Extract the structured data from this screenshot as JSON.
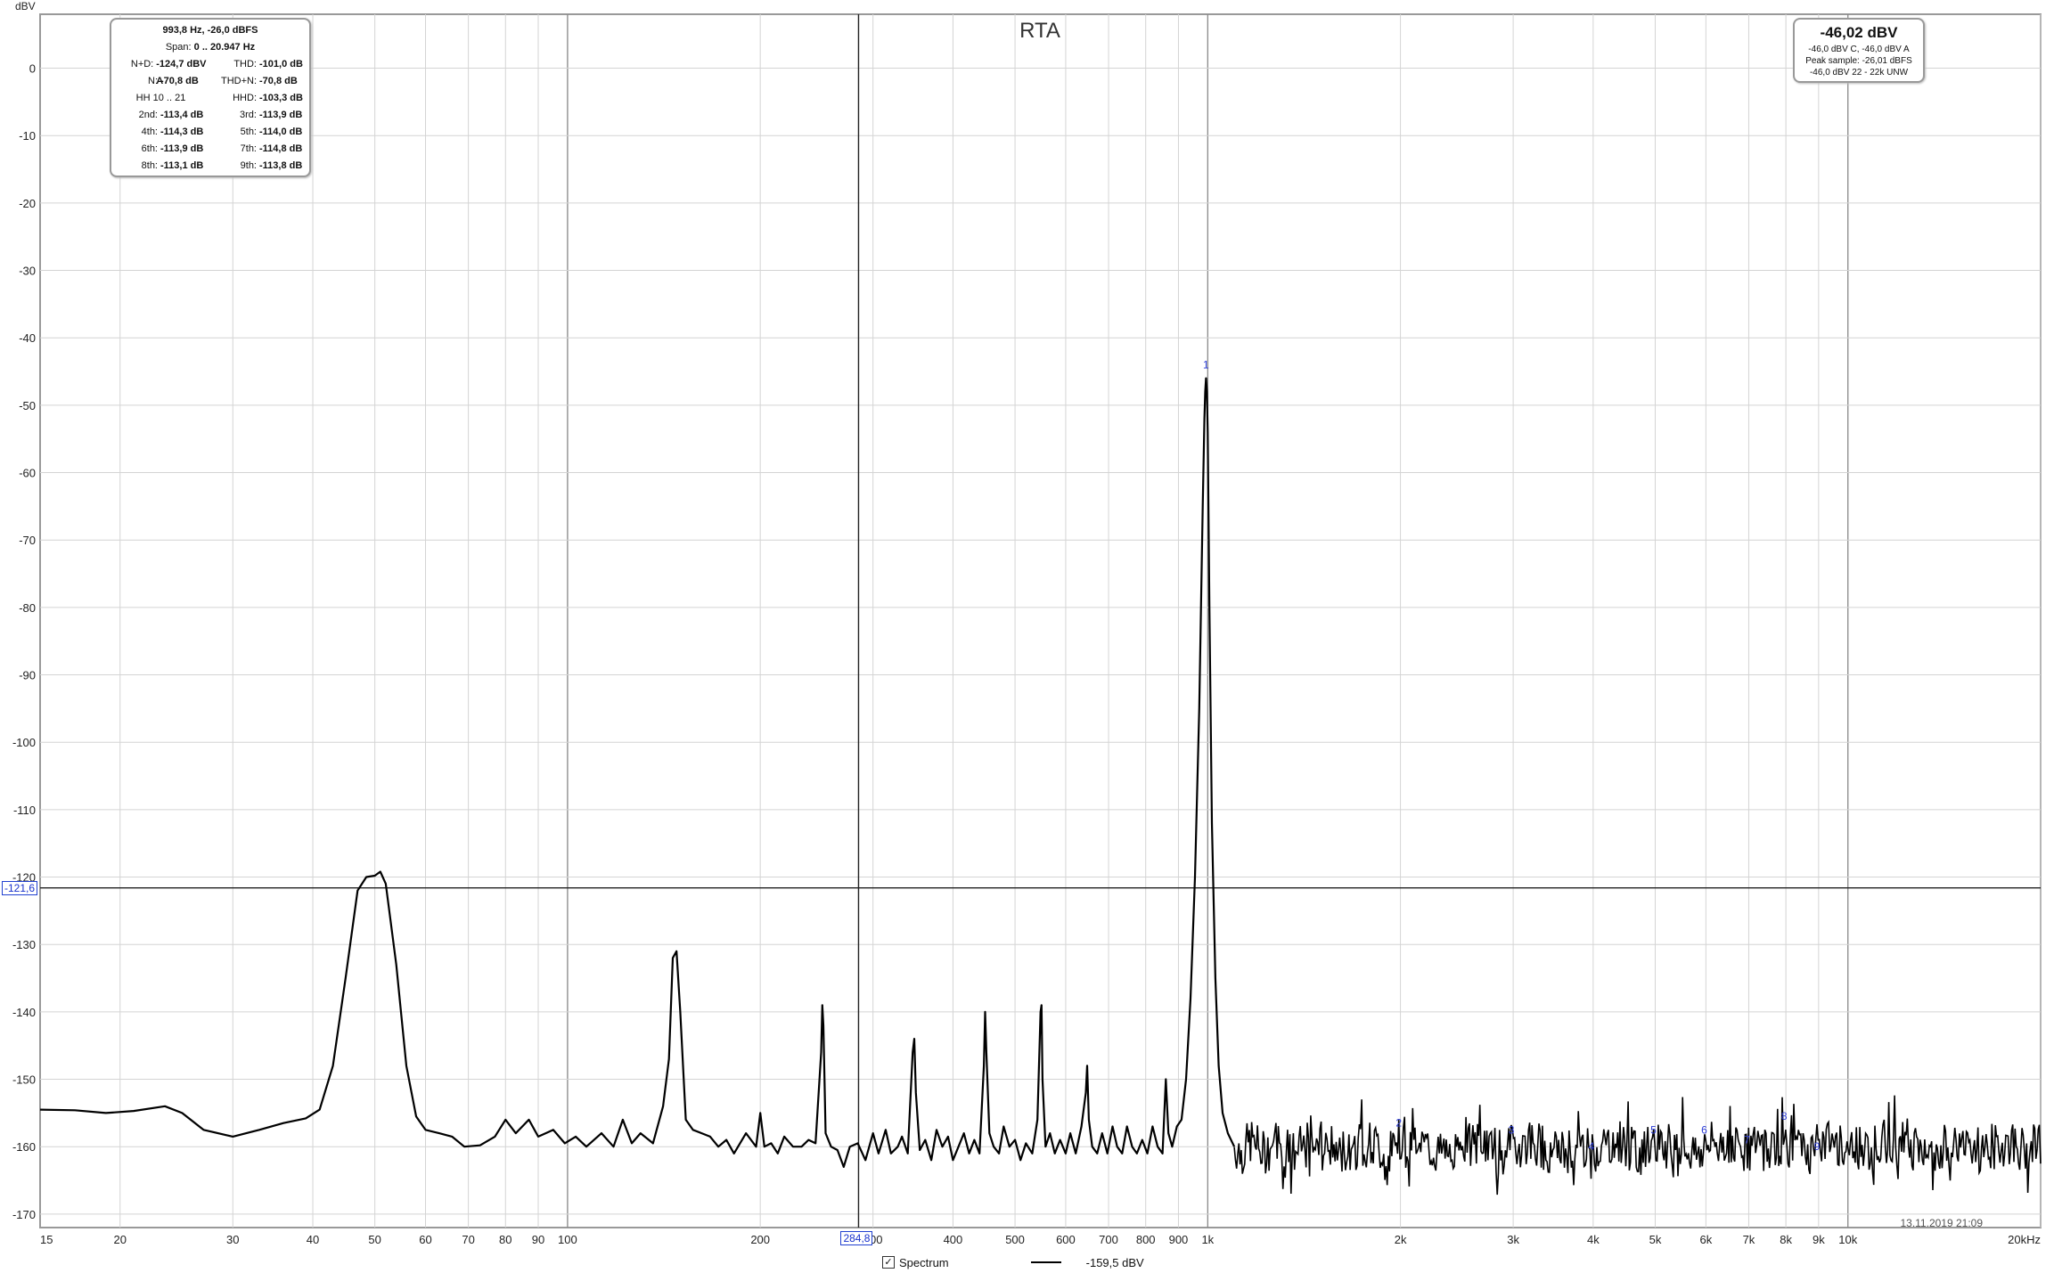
{
  "title": "RTA",
  "y_unit_label": "dBV",
  "timestamp": "13.11.2019 21:09",
  "stats_box": {
    "header": "993,8 Hz, -26,0 dBFS",
    "span_label": "Span:",
    "span_value": "0 .. 20.947 Hz",
    "rows": [
      {
        "k1": "N+D:",
        "v1": "-124,7 dBV A",
        "k2": "THD:",
        "v2": "-101,0 dB"
      },
      {
        "k1": "N:",
        "v1": "-70,8 dB",
        "k2": "THD+N:",
        "v2": "-70,8 dB"
      },
      {
        "k1": "",
        "v1": "HH 10 .. 21",
        "k2": "HHD:",
        "v2": "-103,3 dB"
      },
      {
        "k1": "2nd:",
        "v1": "-113,4 dB",
        "k2": "3rd:",
        "v2": "-113,9 dB"
      },
      {
        "k1": "4th:",
        "v1": "-114,3 dB",
        "k2": "5th:",
        "v2": "-114,0 dB"
      },
      {
        "k1": "6th:",
        "v1": "-113,9 dB",
        "k2": "7th:",
        "v2": "-114,8 dB"
      },
      {
        "k1": "8th:",
        "v1": "-113,1 dB",
        "k2": "9th:",
        "v2": "-113,8 dB"
      }
    ]
  },
  "level_box": {
    "main": "-46,02 dBV",
    "line1": "-46,0 dBV C, -46,0 dBV A",
    "line2": "Peak sample: -26,01 dBFS",
    "line3": "-46,0 dBV 22 - 22k UNW"
  },
  "cursor": {
    "x_label": "284,8",
    "y_label": "-121,6",
    "x_value": 284.8,
    "y_value": -121.6
  },
  "legend": {
    "checkbox_mark": "✓",
    "series_name": "Spectrum",
    "series_value": "-159,5 dBV"
  },
  "chart_data": {
    "type": "line",
    "title": "RTA",
    "ylabel": "dBV",
    "xlabel": "",
    "x_scale": "log",
    "xlim": [
      15,
      20000
    ],
    "ylim": [
      -172,
      8
    ],
    "grid": true,
    "y_ticks": [
      0,
      -10,
      -20,
      -30,
      -40,
      -50,
      -60,
      -70,
      -80,
      -90,
      -100,
      -110,
      -120,
      -130,
      -140,
      -150,
      -160,
      -170
    ],
    "x_ticks": [
      {
        "v": 15,
        "label": "15"
      },
      {
        "v": 20,
        "label": "20"
      },
      {
        "v": 30,
        "label": "30"
      },
      {
        "v": 40,
        "label": "40"
      },
      {
        "v": 50,
        "label": "50"
      },
      {
        "v": 60,
        "label": "60"
      },
      {
        "v": 70,
        "label": "70"
      },
      {
        "v": 80,
        "label": "80"
      },
      {
        "v": 90,
        "label": "90"
      },
      {
        "v": 100,
        "label": "100"
      },
      {
        "v": 200,
        "label": "200"
      },
      {
        "v": 300,
        "label": "300"
      },
      {
        "v": 400,
        "label": "400"
      },
      {
        "v": 500,
        "label": "500"
      },
      {
        "v": 600,
        "label": "600"
      },
      {
        "v": 700,
        "label": "700"
      },
      {
        "v": 800,
        "label": "800"
      },
      {
        "v": 900,
        "label": "900"
      },
      {
        "v": 1000,
        "label": "1k"
      },
      {
        "v": 2000,
        "label": "2k"
      },
      {
        "v": 3000,
        "label": "3k"
      },
      {
        "v": 4000,
        "label": "4k"
      },
      {
        "v": 5000,
        "label": "5k"
      },
      {
        "v": 6000,
        "label": "6k"
      },
      {
        "v": 7000,
        "label": "7k"
      },
      {
        "v": 8000,
        "label": "8k"
      },
      {
        "v": 9000,
        "label": "9k"
      },
      {
        "v": 10000,
        "label": "10k"
      },
      {
        "v": 20000,
        "label": "20kHz"
      }
    ],
    "series": [
      {
        "name": "Spectrum",
        "points": [
          [
            15,
            -154.5
          ],
          [
            17,
            -154.6
          ],
          [
            19,
            -155
          ],
          [
            21,
            -154.7
          ],
          [
            23.5,
            -154
          ],
          [
            25,
            -155
          ],
          [
            27,
            -157.5
          ],
          [
            30,
            -158.5
          ],
          [
            33,
            -157.5
          ],
          [
            36,
            -156.5
          ],
          [
            39,
            -155.8
          ],
          [
            41,
            -154.5
          ],
          [
            43,
            -148
          ],
          [
            45,
            -135
          ],
          [
            47,
            -122
          ],
          [
            48.5,
            -120
          ],
          [
            50,
            -119.8
          ],
          [
            51,
            -119.2
          ],
          [
            52,
            -121
          ],
          [
            54,
            -133
          ],
          [
            56,
            -148
          ],
          [
            58,
            -155.5
          ],
          [
            60,
            -157.5
          ],
          [
            63,
            -158
          ],
          [
            66,
            -158.5
          ],
          [
            69,
            -160
          ],
          [
            73,
            -159.8
          ],
          [
            77,
            -158.5
          ],
          [
            80,
            -156
          ],
          [
            83,
            -158
          ],
          [
            87,
            -156
          ],
          [
            90,
            -158.5
          ],
          [
            95,
            -157.5
          ],
          [
            99,
            -159.5
          ],
          [
            103,
            -158.5
          ],
          [
            107,
            -160
          ],
          [
            113,
            -158
          ],
          [
            118,
            -160
          ],
          [
            122,
            -156
          ],
          [
            126,
            -159.5
          ],
          [
            130,
            -158
          ],
          [
            136,
            -159.5
          ],
          [
            141,
            -154
          ],
          [
            144,
            -147
          ],
          [
            146,
            -132
          ],
          [
            148,
            -131
          ],
          [
            150,
            -140
          ],
          [
            153,
            -156
          ],
          [
            157,
            -157.5
          ],
          [
            162,
            -158
          ],
          [
            167,
            -158.5
          ],
          [
            172,
            -160
          ],
          [
            177,
            -159
          ],
          [
            182,
            -161
          ],
          [
            190,
            -158
          ],
          [
            197,
            -160
          ],
          [
            200,
            -155
          ],
          [
            203,
            -160
          ],
          [
            208,
            -159.5
          ],
          [
            213,
            -161
          ],
          [
            218,
            -158.5
          ],
          [
            225,
            -160
          ],
          [
            232,
            -160
          ],
          [
            238,
            -159
          ],
          [
            244,
            -159.5
          ],
          [
            249,
            -146
          ],
          [
            250,
            -139
          ],
          [
            251,
            -142
          ],
          [
            253,
            -158
          ],
          [
            258,
            -160
          ],
          [
            264,
            -160.5
          ],
          [
            270,
            -163
          ],
          [
            276,
            -160
          ],
          [
            284,
            -159.5
          ],
          [
            292,
            -162
          ],
          [
            300,
            -158
          ],
          [
            306,
            -161
          ],
          [
            314,
            -157.5
          ],
          [
            320,
            -161
          ],
          [
            328,
            -160
          ],
          [
            333,
            -158.5
          ],
          [
            340,
            -161
          ],
          [
            346,
            -146
          ],
          [
            348,
            -144
          ],
          [
            350,
            -152
          ],
          [
            355,
            -160.5
          ],
          [
            362,
            -159
          ],
          [
            370,
            -162
          ],
          [
            377,
            -157.5
          ],
          [
            385,
            -160
          ],
          [
            393,
            -158.5
          ],
          [
            400,
            -162
          ],
          [
            408,
            -160
          ],
          [
            416,
            -158
          ],
          [
            424,
            -161
          ],
          [
            432,
            -159
          ],
          [
            440,
            -161
          ],
          [
            447,
            -148
          ],
          [
            449,
            -140
          ],
          [
            451,
            -146
          ],
          [
            456,
            -158
          ],
          [
            463,
            -160
          ],
          [
            472,
            -161
          ],
          [
            480,
            -157
          ],
          [
            490,
            -160
          ],
          [
            500,
            -159
          ],
          [
            510,
            -162
          ],
          [
            520,
            -159.5
          ],
          [
            532,
            -161
          ],
          [
            542,
            -156
          ],
          [
            548,
            -140
          ],
          [
            550,
            -139
          ],
          [
            552,
            -150
          ],
          [
            558,
            -160
          ],
          [
            567,
            -158
          ],
          [
            577,
            -161
          ],
          [
            588,
            -159
          ],
          [
            600,
            -161
          ],
          [
            610,
            -158
          ],
          [
            622,
            -161
          ],
          [
            635,
            -157
          ],
          [
            645,
            -152
          ],
          [
            648,
            -148
          ],
          [
            652,
            -156
          ],
          [
            660,
            -160
          ],
          [
            672,
            -161
          ],
          [
            684,
            -158
          ],
          [
            697,
            -161
          ],
          [
            710,
            -157
          ],
          [
            722,
            -160
          ],
          [
            735,
            -161
          ],
          [
            748,
            -157
          ],
          [
            762,
            -160
          ],
          [
            775,
            -161
          ],
          [
            790,
            -159
          ],
          [
            805,
            -161
          ],
          [
            820,
            -157
          ],
          [
            835,
            -160
          ],
          [
            850,
            -161
          ],
          [
            860,
            -150
          ],
          [
            868,
            -158
          ],
          [
            880,
            -160
          ],
          [
            895,
            -157
          ],
          [
            910,
            -156
          ],
          [
            925,
            -150
          ],
          [
            940,
            -138
          ],
          [
            955,
            -120
          ],
          [
            970,
            -95
          ],
          [
            982,
            -65
          ],
          [
            988,
            -52
          ],
          [
            991,
            -48
          ],
          [
            993.8,
            -46
          ],
          [
            997,
            -48
          ],
          [
            1000,
            -54
          ],
          [
            1006,
            -80
          ],
          [
            1015,
            -112
          ],
          [
            1028,
            -135
          ],
          [
            1040,
            -148
          ],
          [
            1055,
            -155
          ],
          [
            1075,
            -158
          ],
          [
            1100,
            -160
          ],
          [
            1130,
            -161
          ],
          [
            1170,
            -159
          ],
          [
            1220,
            -161
          ],
          [
            1280,
            -159
          ],
          [
            1350,
            -161
          ],
          [
            1420,
            -160
          ],
          [
            1500,
            -159
          ],
          [
            1600,
            -161
          ],
          [
            1700,
            -160
          ],
          [
            1800,
            -159.5
          ],
          [
            1900,
            -161
          ],
          [
            2000,
            -160
          ],
          [
            2100,
            -159
          ],
          [
            2300,
            -161
          ],
          [
            2500,
            -160
          ],
          [
            2700,
            -159.5
          ],
          [
            2900,
            -161
          ],
          [
            3000,
            -160
          ],
          [
            3200,
            -159
          ],
          [
            3500,
            -161
          ],
          [
            3800,
            -160
          ],
          [
            4000,
            -160.5
          ],
          [
            4300,
            -159
          ],
          [
            4700,
            -161
          ],
          [
            5000,
            -160
          ],
          [
            5400,
            -159.5
          ],
          [
            5800,
            -161
          ],
          [
            6000,
            -160
          ],
          [
            6500,
            -159
          ],
          [
            7000,
            -160.5
          ],
          [
            7500,
            -160
          ],
          [
            8000,
            -159.5
          ],
          [
            8500,
            -161
          ],
          [
            9000,
            -160
          ],
          [
            9500,
            -159
          ],
          [
            10000,
            -160.5
          ],
          [
            11000,
            -160
          ],
          [
            12000,
            -159.5
          ],
          [
            13000,
            -161
          ],
          [
            14000,
            -160
          ],
          [
            15000,
            -159
          ],
          [
            16000,
            -160.5
          ],
          [
            17000,
            -160
          ],
          [
            18000,
            -159.5
          ],
          [
            19000,
            -161
          ],
          [
            20000,
            -160
          ]
        ]
      }
    ],
    "annotations": [
      {
        "label": "1",
        "x": 993.8,
        "y": -44
      },
      {
        "label": "2",
        "x": 1988,
        "y": -156.5
      },
      {
        "label": "3",
        "x": 2981,
        "y": -157.5
      },
      {
        "label": "4",
        "x": 3975,
        "y": -160
      },
      {
        "label": "5",
        "x": 4969,
        "y": -157.5
      },
      {
        "label": "6",
        "x": 5963,
        "y": -157.5
      },
      {
        "label": "7",
        "x": 6957,
        "y": -159
      },
      {
        "label": "8",
        "x": 7950,
        "y": -155.5
      },
      {
        "label": "9",
        "x": 8944,
        "y": -160
      }
    ]
  }
}
